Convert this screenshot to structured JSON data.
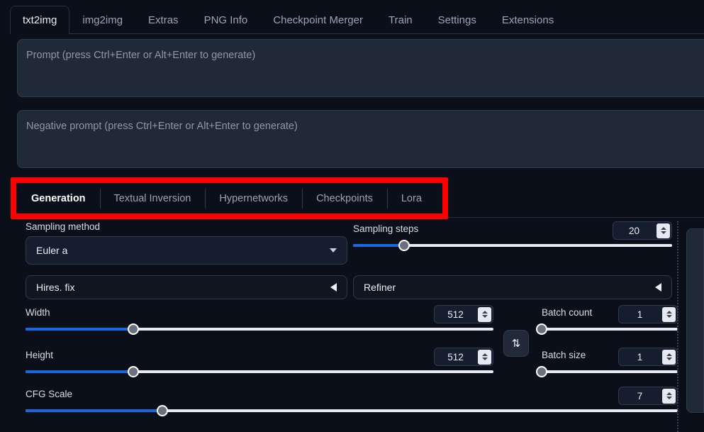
{
  "app": {
    "accent_blue": "#1668e3",
    "annotation_color": "#ff0000",
    "background": "#0b0f19"
  },
  "top_tabs": [
    {
      "label": "txt2img",
      "active": true
    },
    {
      "label": "img2img",
      "active": false
    },
    {
      "label": "Extras",
      "active": false
    },
    {
      "label": "PNG Info",
      "active": false
    },
    {
      "label": "Checkpoint Merger",
      "active": false
    },
    {
      "label": "Train",
      "active": false
    },
    {
      "label": "Settings",
      "active": false
    },
    {
      "label": "Extensions",
      "active": false
    }
  ],
  "prompt": {
    "value": "",
    "placeholder": "Prompt (press Ctrl+Enter or Alt+Enter to generate)"
  },
  "negative_prompt": {
    "value": "",
    "placeholder": "Negative prompt (press Ctrl+Enter or Alt+Enter to generate)"
  },
  "inner_tabs": [
    {
      "label": "Generation",
      "active": true
    },
    {
      "label": "Textual Inversion",
      "active": false
    },
    {
      "label": "Hypernetworks",
      "active": false
    },
    {
      "label": "Checkpoints",
      "active": false
    },
    {
      "label": "Lora",
      "active": false
    }
  ],
  "generation": {
    "sampling_method": {
      "label": "Sampling method",
      "value": "Euler a",
      "caret_icon": "chevron-down-icon"
    },
    "sampling_steps": {
      "label": "Sampling steps",
      "value": "20",
      "percent": 16
    },
    "hires_fix": {
      "label": "Hires. fix",
      "arrow_icon": "triangle-left-icon",
      "expanded": false
    },
    "refiner": {
      "label": "Refiner",
      "arrow_icon": "triangle-left-icon",
      "expanded": false
    },
    "width": {
      "label": "Width",
      "value": "512",
      "percent": 23
    },
    "height": {
      "label": "Height",
      "value": "512",
      "percent": 23
    },
    "swap_button": {
      "icon": "swap-vertical-icon",
      "glyph": "⇅"
    },
    "batch_count": {
      "label": "Batch count",
      "value": "1",
      "percent": 0
    },
    "batch_size": {
      "label": "Batch size",
      "value": "1",
      "percent": 0
    },
    "cfg_scale": {
      "label": "CFG Scale",
      "value": "7",
      "percent": 21
    }
  }
}
